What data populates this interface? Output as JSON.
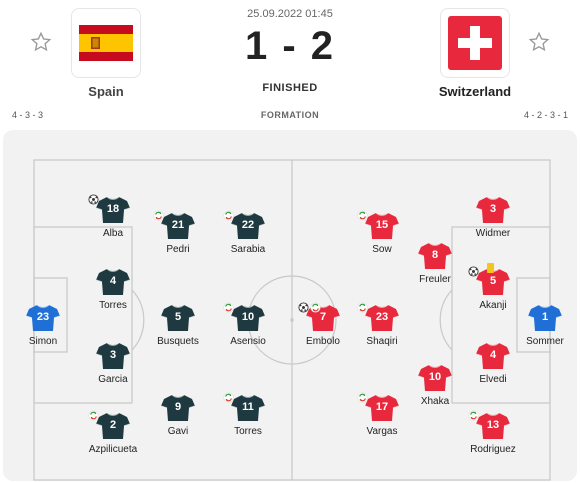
{
  "match": {
    "date": "25.09.2022 01:45",
    "score": "1 - 2",
    "status": "FINISHED"
  },
  "home": {
    "name": "Spain",
    "formation": "4 - 3 - 3",
    "shirt_color": "#1e3a40",
    "players": [
      {
        "number": "23",
        "name": "Simon",
        "goalkeeper": true
      },
      {
        "number": "18",
        "name": "Alba",
        "icons": [
          "ball"
        ]
      },
      {
        "number": "4",
        "name": "Torres"
      },
      {
        "number": "3",
        "name": "Garcia"
      },
      {
        "number": "2",
        "name": "Azpilicueta",
        "icons": [
          "sub"
        ]
      },
      {
        "number": "21",
        "name": "Pedri",
        "icons": [
          "sub"
        ]
      },
      {
        "number": "5",
        "name": "Busquets"
      },
      {
        "number": "9",
        "name": "Gavi"
      },
      {
        "number": "22",
        "name": "Sarabia",
        "icons": [
          "sub"
        ]
      },
      {
        "number": "10",
        "name": "Asensio",
        "icons": [
          "sub"
        ]
      },
      {
        "number": "11",
        "name": "Torres",
        "icons": [
          "sub"
        ]
      }
    ]
  },
  "away": {
    "name": "Switzerland",
    "formation": "4 - 2 - 3 - 1",
    "shirt_color": "#e8283c",
    "players": [
      {
        "number": "1",
        "name": "Sommer",
        "goalkeeper": true
      },
      {
        "number": "3",
        "name": "Widmer"
      },
      {
        "number": "5",
        "name": "Akanji",
        "icons": [
          "ball",
          "card"
        ]
      },
      {
        "number": "4",
        "name": "Elvedi"
      },
      {
        "number": "13",
        "name": "Rodriguez",
        "icons": [
          "sub"
        ]
      },
      {
        "number": "8",
        "name": "Freuler"
      },
      {
        "number": "10",
        "name": "Xhaka"
      },
      {
        "number": "15",
        "name": "Sow",
        "icons": [
          "sub"
        ]
      },
      {
        "number": "23",
        "name": "Shaqiri",
        "icons": [
          "sub"
        ]
      },
      {
        "number": "17",
        "name": "Vargas",
        "icons": [
          "sub"
        ]
      },
      {
        "number": "7",
        "name": "Embolo",
        "icons": [
          "ball",
          "sub"
        ]
      }
    ]
  },
  "formation_title": "FORMATION",
  "colors": {
    "goalkeeper_shirt": "#1f6fd6",
    "pitch": "#f2f2f2",
    "lines": "#c8c8c8",
    "card": "#f5c518"
  }
}
